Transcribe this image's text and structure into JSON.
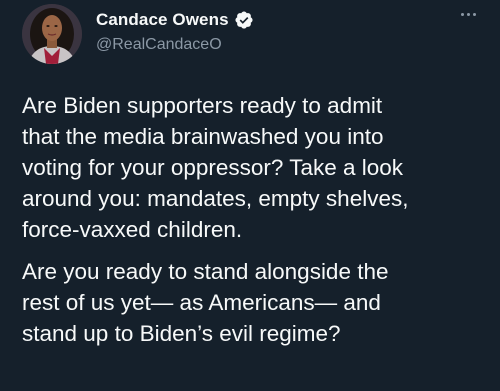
{
  "tweet": {
    "display_name": "Candace Owens",
    "handle": "@RealCandaceO",
    "verified": true,
    "paragraphs": [
      {
        "lines": [
          "Are Biden supporters ready to admit",
          "that the media brainwashed you into",
          "voting for your oppressor? Take a look",
          "around you: mandates, empty shelves,",
          "force-vaxxed children."
        ]
      },
      {
        "lines": [
          "Are you ready to stand alongside the",
          "rest of us yet— as Americans— and",
          "stand up to Biden’s evil regime?"
        ]
      }
    ]
  },
  "icons": {
    "verified": "verified-badge-icon",
    "more": "more-options-icon"
  },
  "colors": {
    "background": "#15202b",
    "text": "#f7f9f9",
    "secondary_text": "#8b98a5",
    "verified_blue": "#1d9bf0"
  }
}
